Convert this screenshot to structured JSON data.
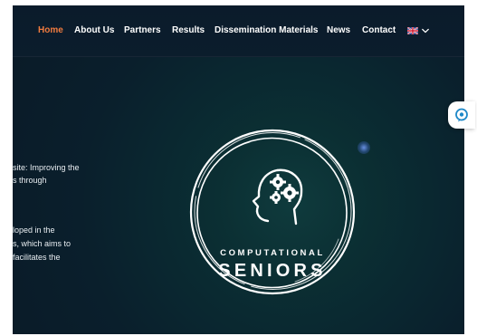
{
  "nav": {
    "items": [
      {
        "label": "Home",
        "active": true
      },
      {
        "label": "About Us",
        "active": false
      },
      {
        "label": "Partners",
        "active": false
      },
      {
        "label": "Results",
        "active": false
      },
      {
        "label": "Dissemination Materials",
        "active": false
      },
      {
        "label": "News",
        "active": false
      },
      {
        "label": "Contact",
        "active": false
      }
    ],
    "language_icon": "uk-flag-icon",
    "dropdown_icon": "chevron-down-icon"
  },
  "hero": {
    "text_lines": [
      "site: Improving the",
      "s through",
      "loped in the",
      "s, which aims to",
      " facilitates the"
    ]
  },
  "logo": {
    "line1": "COMPUTATIONAL",
    "line2": "SENIORS",
    "icon": "head-with-gears-icon"
  },
  "side_button": {
    "icon": "chat-bubble-icon"
  },
  "colors": {
    "accent": "#f07b3f",
    "nav_bg": "#0b1b2b",
    "hero_center": "#0f3b3d",
    "hero_edge": "#0a1a27",
    "side_icon": "#1e88c8"
  }
}
